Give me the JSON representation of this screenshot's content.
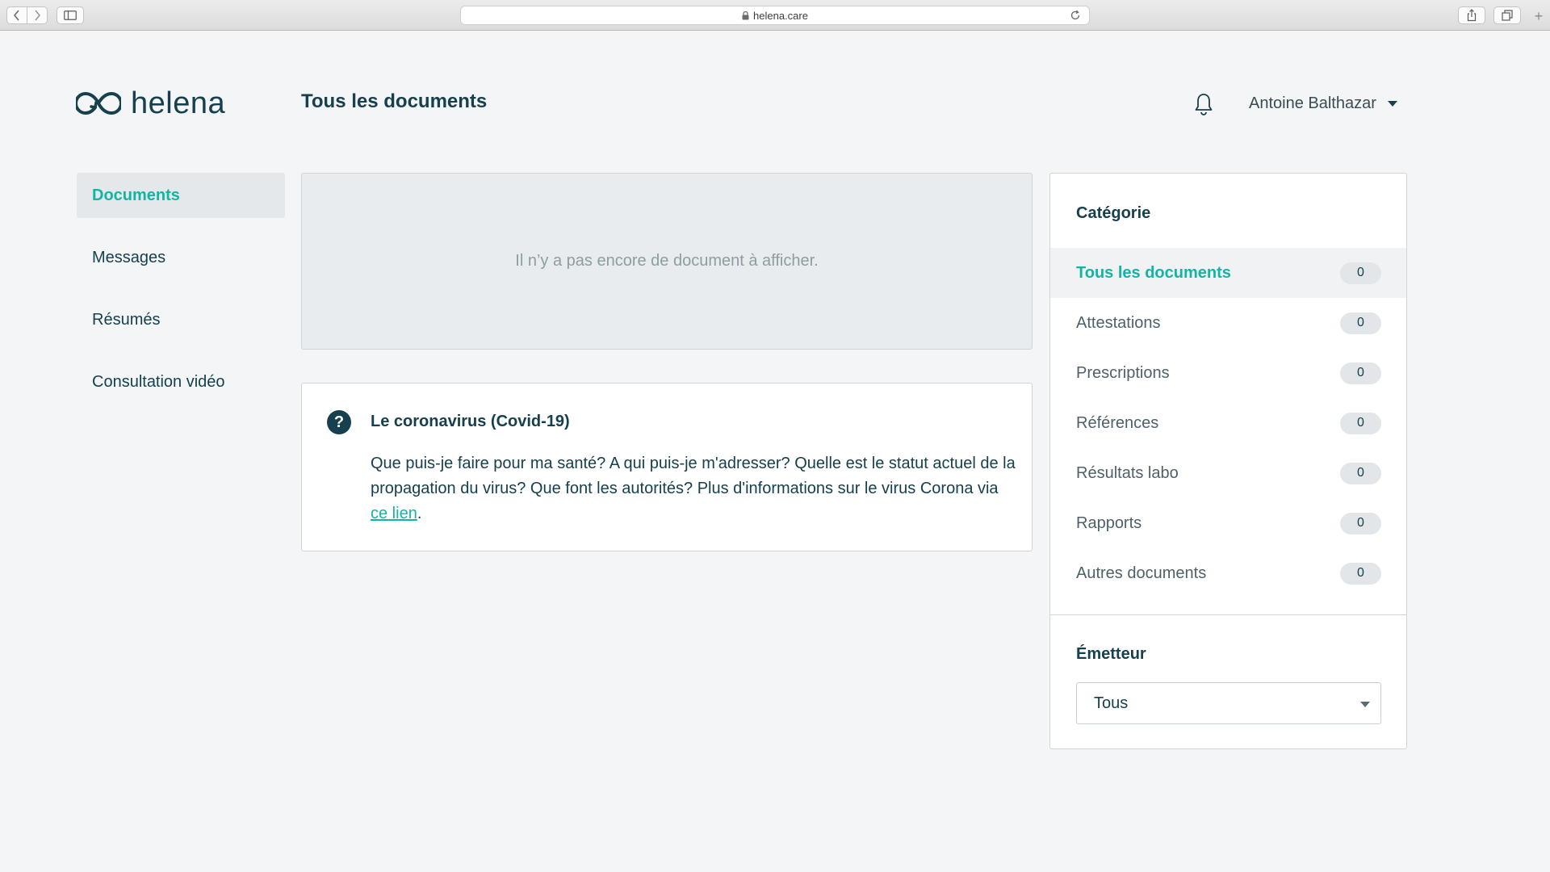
{
  "browser": {
    "url": "helena.care",
    "new_tab": "+"
  },
  "header": {
    "logo_text": "helena",
    "page_title": "Tous les documents",
    "user_name": "Antoine Balthazar"
  },
  "sidebar": {
    "items": [
      {
        "label": "Documents",
        "active": true
      },
      {
        "label": "Messages"
      },
      {
        "label": "Résumés"
      },
      {
        "label": "Consultation vidéo"
      }
    ]
  },
  "main": {
    "empty_message": "Il n’y a pas encore de document à afficher.",
    "info": {
      "icon": "?",
      "title": "Le coronavirus (Covid-19)",
      "body_text": "Que puis-je faire pour ma santé? A qui puis-je m'adresser? Quelle est le statut actuel de la propagation du virus? Que font les autorités? Plus d'informations sur le virus Corona via ",
      "link_text": "ce lien",
      "trailing": "."
    }
  },
  "filters": {
    "category_heading": "Catégorie",
    "categories": [
      {
        "label": "Tous les documents",
        "count": "0",
        "active": true
      },
      {
        "label": "Attestations",
        "count": "0"
      },
      {
        "label": "Prescriptions",
        "count": "0"
      },
      {
        "label": "Références",
        "count": "0"
      },
      {
        "label": "Résultats labo",
        "count": "0"
      },
      {
        "label": "Rapports",
        "count": "0"
      },
      {
        "label": "Autres documents",
        "count": "0"
      }
    ],
    "emitter_heading": "Émetteur",
    "emitter_value": "Tous"
  },
  "colors": {
    "accent": "#12b5a5",
    "primary_text": "#16404d",
    "background": "#f4f5f7"
  }
}
